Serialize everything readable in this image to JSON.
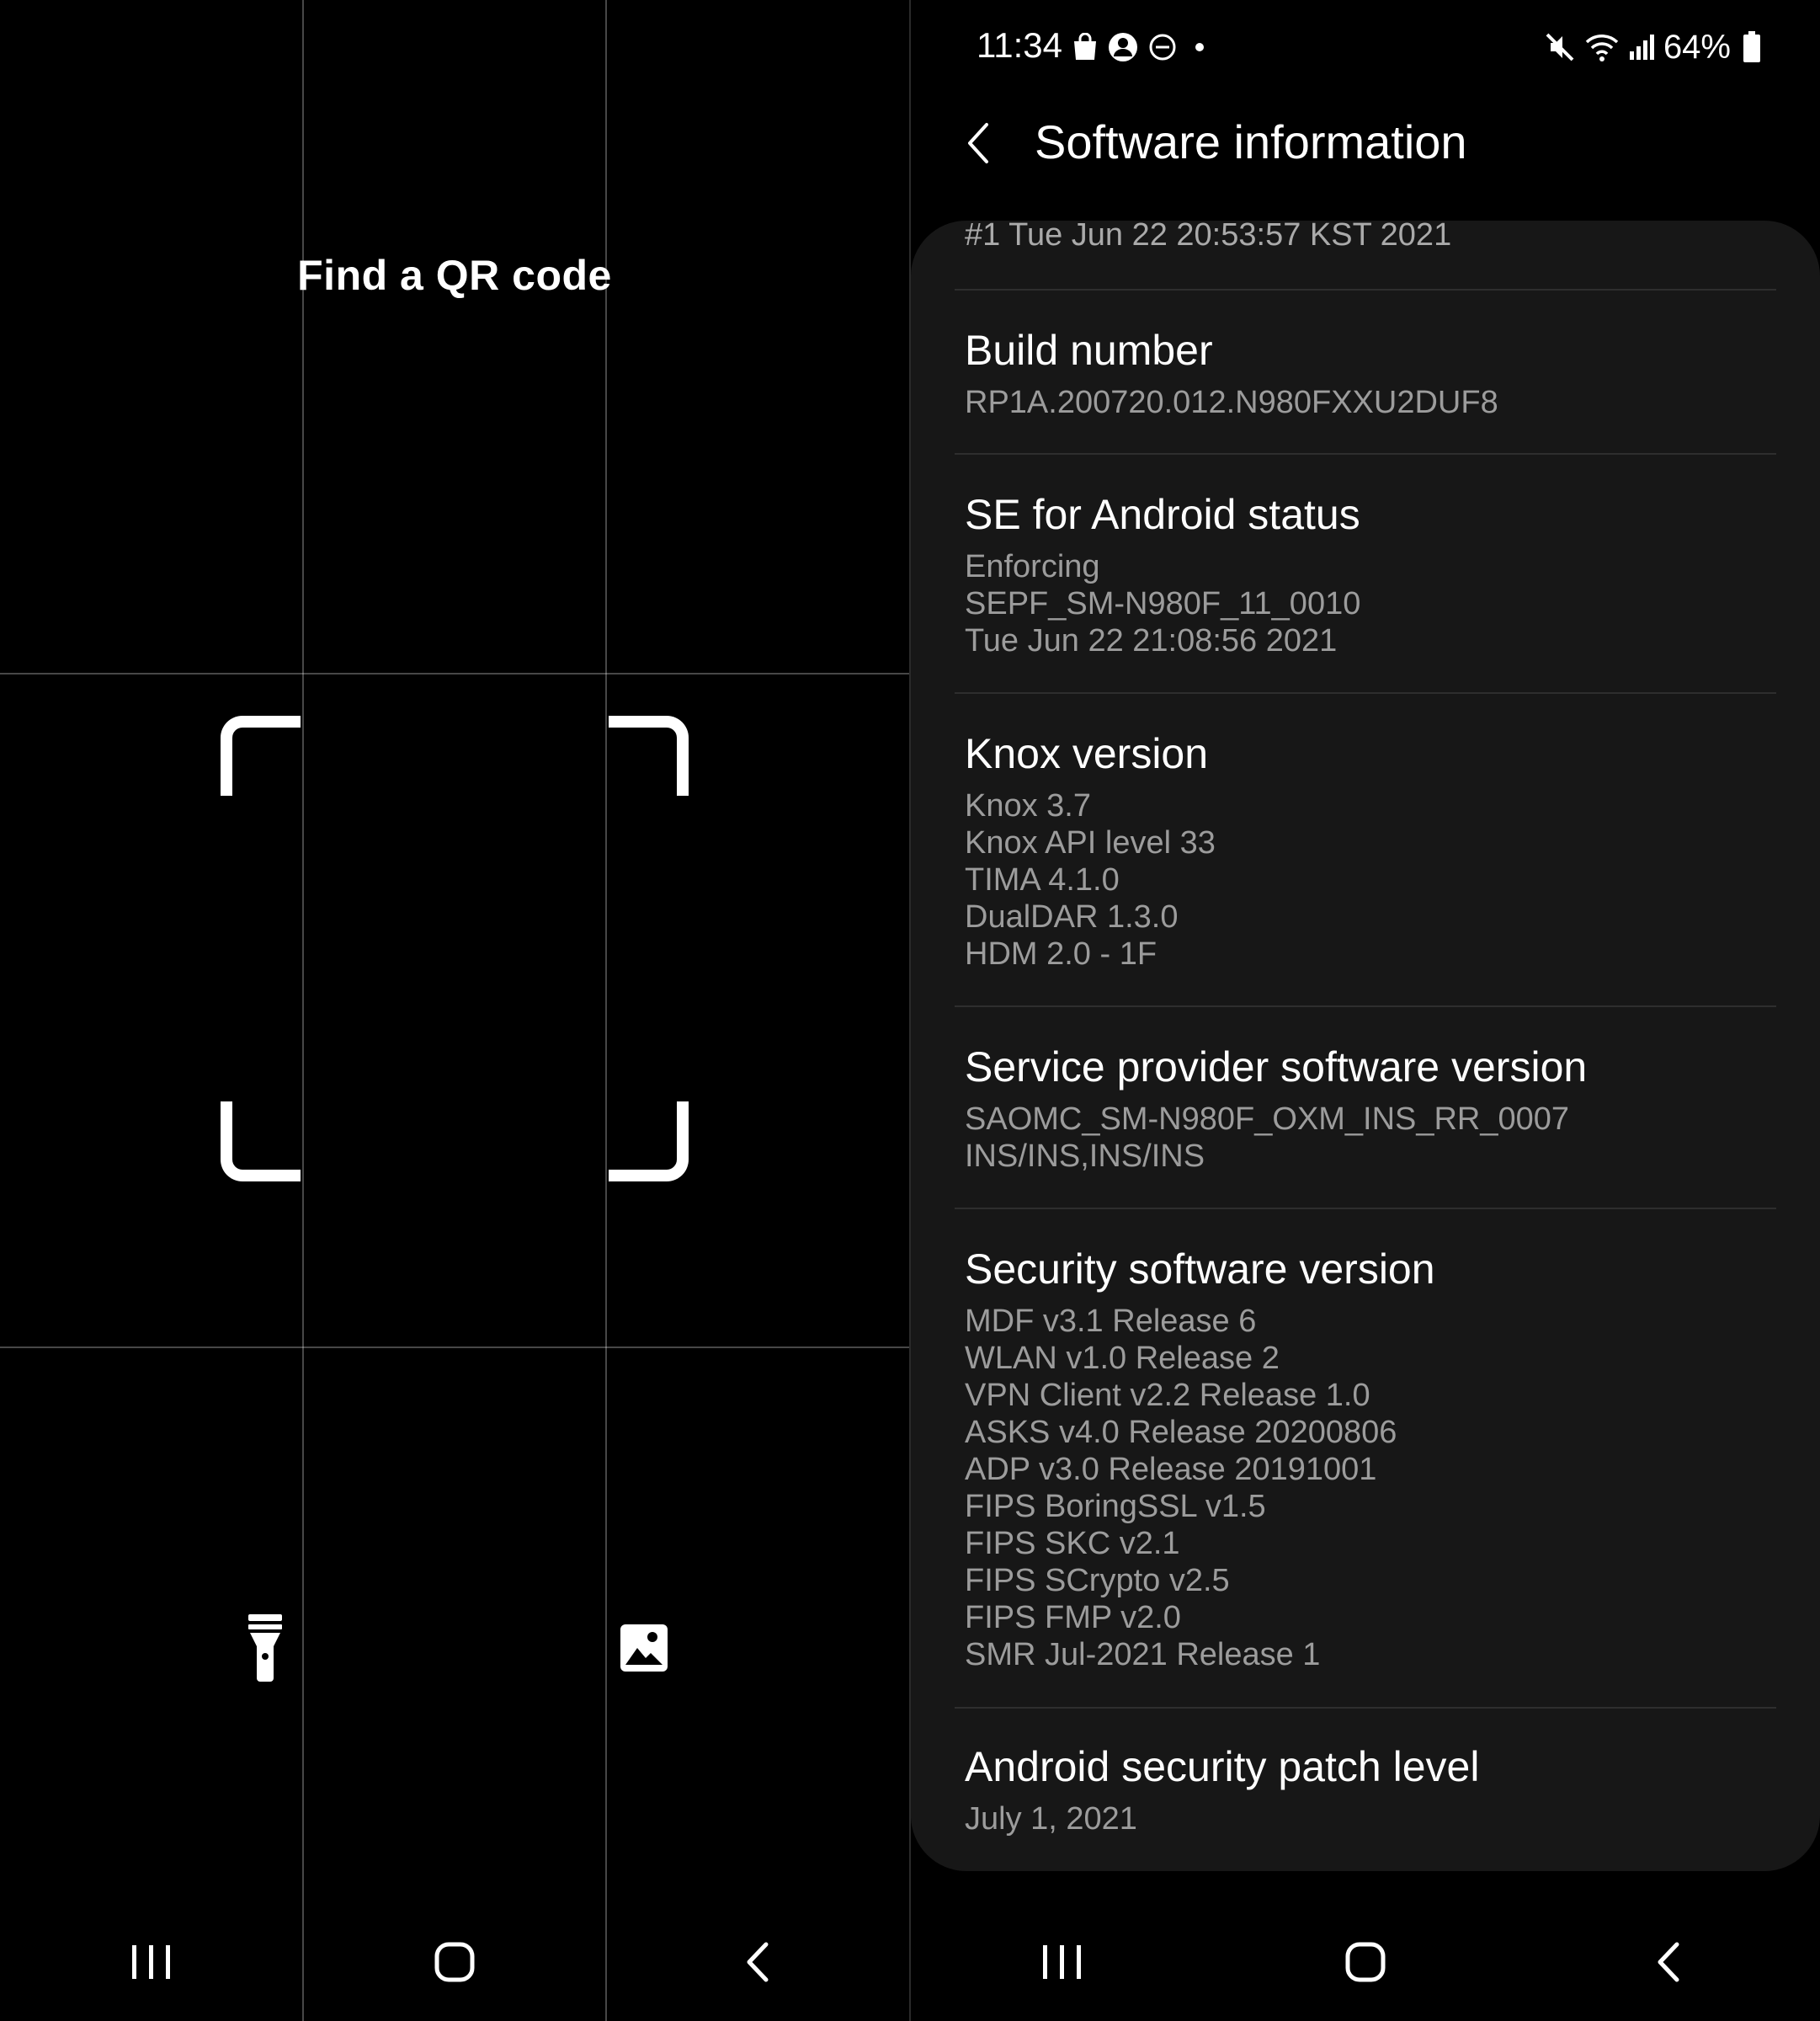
{
  "qr_scanner": {
    "title": "Find a QR code",
    "flash_icon": "flashlight-icon",
    "gallery_icon": "image-gallery-icon"
  },
  "status_bar": {
    "time": "11:34",
    "battery": "64%",
    "icons_left": [
      "shopping-bag-icon",
      "account-icon",
      "do-not-disturb-icon",
      "dot-icon"
    ],
    "icons_right": [
      "mute-icon",
      "wifi-icon",
      "signal-icon",
      "battery-icon"
    ]
  },
  "settings": {
    "page_title": "Software information",
    "truncated_value": "#1 Tue Jun 22 20:53:57 KST 2021",
    "items": [
      {
        "title": "Build number",
        "lines": [
          "RP1A.200720.012.N980FXXU2DUF8"
        ]
      },
      {
        "title": "SE for Android status",
        "lines": [
          "Enforcing",
          "SEPF_SM-N980F_11_0010",
          "Tue Jun 22 21:08:56 2021"
        ]
      },
      {
        "title": "Knox version",
        "lines": [
          "Knox 3.7",
          "Knox API level 33",
          "TIMA 4.1.0",
          "DualDAR 1.3.0",
          "HDM 2.0 - 1F"
        ]
      },
      {
        "title": "Service provider software version",
        "lines": [
          "SAOMC_SM-N980F_OXM_INS_RR_0007",
          "INS/INS,INS/INS"
        ]
      },
      {
        "title": "Security software version",
        "lines": [
          "MDF v3.1 Release 6",
          "WLAN v1.0 Release 2",
          "VPN Client v2.2 Release 1.0",
          "ASKS v4.0 Release 20200806",
          "ADP v3.0 Release 20191001",
          "FIPS BoringSSL v1.5",
          "FIPS SKC v2.1",
          "FIPS SCrypto v2.5",
          "FIPS FMP v2.0",
          "SMR Jul-2021 Release 1"
        ]
      },
      {
        "title": "Android security patch level",
        "lines": [
          "July 1, 2021"
        ]
      }
    ]
  },
  "nav_bar": {
    "buttons": [
      "recent-apps-icon",
      "home-icon",
      "back-icon"
    ]
  },
  "colors": {
    "background": "#000000",
    "card": "#171717",
    "primary_text": "#ffffff",
    "secondary_text": "#9c9c9c"
  }
}
